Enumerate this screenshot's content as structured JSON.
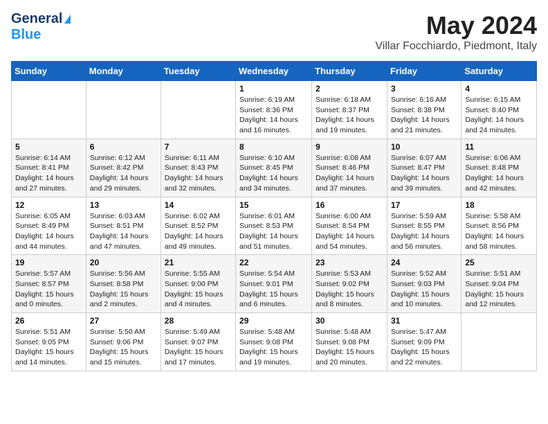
{
  "header": {
    "logo_line1": "General",
    "logo_line2": "Blue",
    "title": "May 2024",
    "subtitle": "Villar Focchiardo, Piedmont, Italy"
  },
  "days_of_week": [
    "Sunday",
    "Monday",
    "Tuesday",
    "Wednesday",
    "Thursday",
    "Friday",
    "Saturday"
  ],
  "weeks": [
    [
      {
        "day": "",
        "info": ""
      },
      {
        "day": "",
        "info": ""
      },
      {
        "day": "",
        "info": ""
      },
      {
        "day": "1",
        "info": "Sunrise: 6:19 AM\nSunset: 8:36 PM\nDaylight: 14 hours and 16 minutes."
      },
      {
        "day": "2",
        "info": "Sunrise: 6:18 AM\nSunset: 8:37 PM\nDaylight: 14 hours and 19 minutes."
      },
      {
        "day": "3",
        "info": "Sunrise: 6:16 AM\nSunset: 8:38 PM\nDaylight: 14 hours and 21 minutes."
      },
      {
        "day": "4",
        "info": "Sunrise: 6:15 AM\nSunset: 8:40 PM\nDaylight: 14 hours and 24 minutes."
      }
    ],
    [
      {
        "day": "5",
        "info": "Sunrise: 6:14 AM\nSunset: 8:41 PM\nDaylight: 14 hours and 27 minutes."
      },
      {
        "day": "6",
        "info": "Sunrise: 6:12 AM\nSunset: 8:42 PM\nDaylight: 14 hours and 29 minutes."
      },
      {
        "day": "7",
        "info": "Sunrise: 6:11 AM\nSunset: 8:43 PM\nDaylight: 14 hours and 32 minutes."
      },
      {
        "day": "8",
        "info": "Sunrise: 6:10 AM\nSunset: 8:45 PM\nDaylight: 14 hours and 34 minutes."
      },
      {
        "day": "9",
        "info": "Sunrise: 6:08 AM\nSunset: 8:46 PM\nDaylight: 14 hours and 37 minutes."
      },
      {
        "day": "10",
        "info": "Sunrise: 6:07 AM\nSunset: 8:47 PM\nDaylight: 14 hours and 39 minutes."
      },
      {
        "day": "11",
        "info": "Sunrise: 6:06 AM\nSunset: 8:48 PM\nDaylight: 14 hours and 42 minutes."
      }
    ],
    [
      {
        "day": "12",
        "info": "Sunrise: 6:05 AM\nSunset: 8:49 PM\nDaylight: 14 hours and 44 minutes."
      },
      {
        "day": "13",
        "info": "Sunrise: 6:03 AM\nSunset: 8:51 PM\nDaylight: 14 hours and 47 minutes."
      },
      {
        "day": "14",
        "info": "Sunrise: 6:02 AM\nSunset: 8:52 PM\nDaylight: 14 hours and 49 minutes."
      },
      {
        "day": "15",
        "info": "Sunrise: 6:01 AM\nSunset: 8:53 PM\nDaylight: 14 hours and 51 minutes."
      },
      {
        "day": "16",
        "info": "Sunrise: 6:00 AM\nSunset: 8:54 PM\nDaylight: 14 hours and 54 minutes."
      },
      {
        "day": "17",
        "info": "Sunrise: 5:59 AM\nSunset: 8:55 PM\nDaylight: 14 hours and 56 minutes."
      },
      {
        "day": "18",
        "info": "Sunrise: 5:58 AM\nSunset: 8:56 PM\nDaylight: 14 hours and 58 minutes."
      }
    ],
    [
      {
        "day": "19",
        "info": "Sunrise: 5:57 AM\nSunset: 8:57 PM\nDaylight: 15 hours and 0 minutes."
      },
      {
        "day": "20",
        "info": "Sunrise: 5:56 AM\nSunset: 8:58 PM\nDaylight: 15 hours and 2 minutes."
      },
      {
        "day": "21",
        "info": "Sunrise: 5:55 AM\nSunset: 9:00 PM\nDaylight: 15 hours and 4 minutes."
      },
      {
        "day": "22",
        "info": "Sunrise: 5:54 AM\nSunset: 9:01 PM\nDaylight: 15 hours and 6 minutes."
      },
      {
        "day": "23",
        "info": "Sunrise: 5:53 AM\nSunset: 9:02 PM\nDaylight: 15 hours and 8 minutes."
      },
      {
        "day": "24",
        "info": "Sunrise: 5:52 AM\nSunset: 9:03 PM\nDaylight: 15 hours and 10 minutes."
      },
      {
        "day": "25",
        "info": "Sunrise: 5:51 AM\nSunset: 9:04 PM\nDaylight: 15 hours and 12 minutes."
      }
    ],
    [
      {
        "day": "26",
        "info": "Sunrise: 5:51 AM\nSunset: 9:05 PM\nDaylight: 15 hours and 14 minutes."
      },
      {
        "day": "27",
        "info": "Sunrise: 5:50 AM\nSunset: 9:06 PM\nDaylight: 15 hours and 15 minutes."
      },
      {
        "day": "28",
        "info": "Sunrise: 5:49 AM\nSunset: 9:07 PM\nDaylight: 15 hours and 17 minutes."
      },
      {
        "day": "29",
        "info": "Sunrise: 5:48 AM\nSunset: 9:08 PM\nDaylight: 15 hours and 19 minutes."
      },
      {
        "day": "30",
        "info": "Sunrise: 5:48 AM\nSunset: 9:08 PM\nDaylight: 15 hours and 20 minutes."
      },
      {
        "day": "31",
        "info": "Sunrise: 5:47 AM\nSunset: 9:09 PM\nDaylight: 15 hours and 22 minutes."
      },
      {
        "day": "",
        "info": ""
      }
    ]
  ]
}
